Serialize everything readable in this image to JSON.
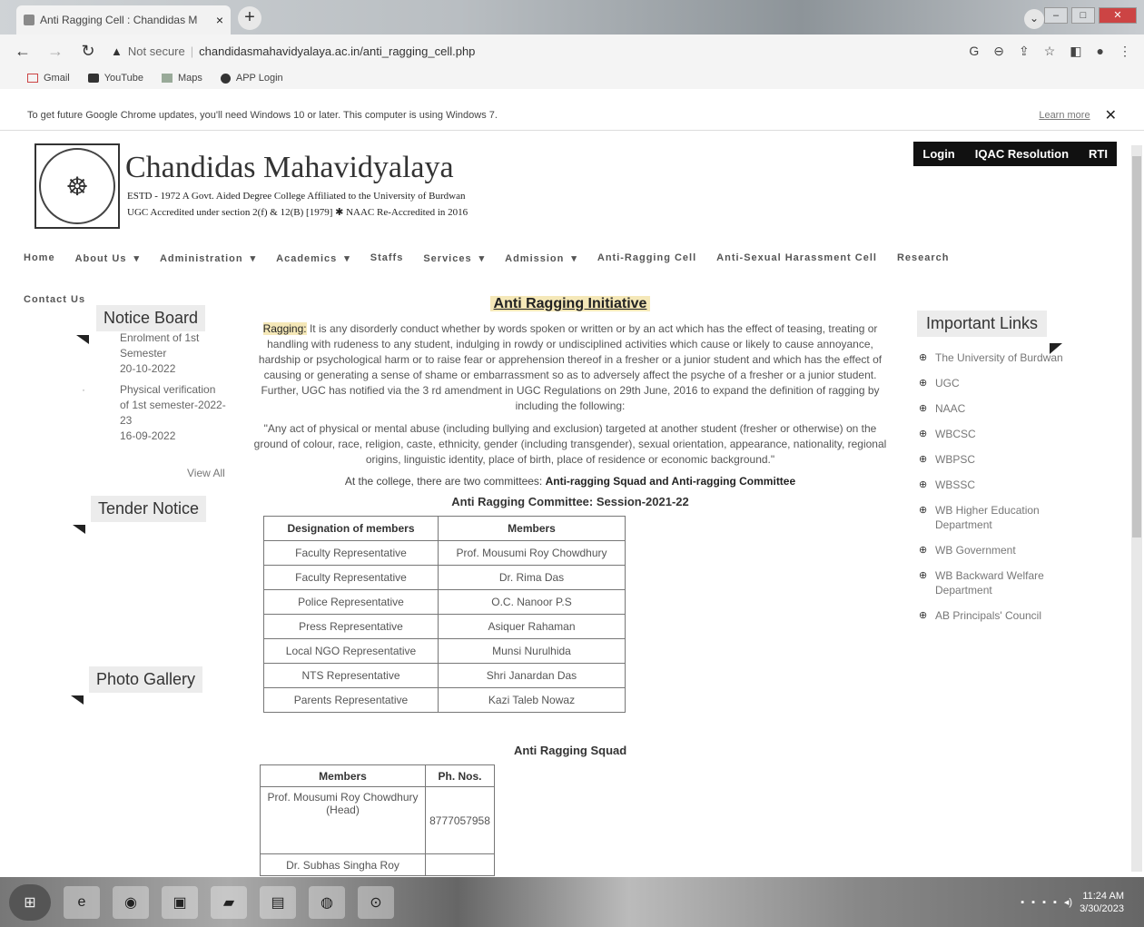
{
  "browser": {
    "tab_title": "Anti Ragging Cell : Chandidas M",
    "tab_close": "×",
    "new_tab": "+",
    "security_label": "Not secure",
    "url": "chandidasmahavidyalaya.ac.in/anti_ragging_cell.php",
    "bookmarks": [
      {
        "label": "Gmail",
        "icon": "gmail-icon"
      },
      {
        "label": "YouTube",
        "icon": "youtube-icon"
      },
      {
        "label": "Maps",
        "icon": "maps-icon"
      },
      {
        "label": "APP Login",
        "icon": "globe-icon"
      }
    ],
    "infobar_message": "To get future Google Chrome updates, you'll need Windows 10 or later. This computer is using Windows 7.",
    "infobar_link": "Learn more",
    "infobar_close": "✕"
  },
  "header": {
    "college_name": "Chandidas Mahavidyalaya",
    "sub1": "ESTD - 1972 A Govt. Aided Degree College Affiliated to the University of Burdwan",
    "sub2": "UGC Accredited under section 2(f) & 12(B) [1979] ✱ NAAC Re-Accredited in 2016",
    "topbar": [
      "Login",
      "IQAC Resolution",
      "RTI"
    ]
  },
  "nav": {
    "items": [
      "Home",
      "About Us",
      "Administration",
      "Academics",
      "Staffs",
      "Services",
      "Admission",
      "Anti-Ragging Cell",
      "Anti-Sexual Harassment Cell",
      "Research"
    ],
    "has_caret": [
      false,
      true,
      true,
      true,
      false,
      true,
      true,
      false,
      false,
      false
    ],
    "contact": "Contact Us"
  },
  "sidebar": {
    "notice_board_title": "Notice Board",
    "notices": [
      {
        "title": "Enrolment of 1st Semester",
        "date": "20-10-2022"
      },
      {
        "title": "Physical verification of 1st semester-2022-23",
        "date": "16-09-2022"
      }
    ],
    "view_all": "View All",
    "tender_title": "Tender Notice",
    "gallery_title": "Photo Gallery"
  },
  "main": {
    "heading": "Anti Ragging Initiative",
    "ragging_word": "Ragging:",
    "para1": "It is any disorderly conduct whether by words spoken or written or by an act which has the effect of teasing, treating or handling with rudeness to any student, indulging in rowdy or undisciplined activities which cause or likely to cause annoyance, hardship or psychological harm or to raise fear or apprehension thereof in a fresher or a junior student and which has the effect of causing or generating a sense of shame or embarrassment so as to adversely affect the psyche of a fresher or a junior student. Further, UGC has notified via the 3 rd amendment in UGC Regulations on 29th June, 2016 to expand the definition of ragging by including the following:",
    "para2": "\"Any act of physical or mental abuse (including bullying and exclusion) targeted at another student (fresher or otherwise) on the ground of colour, race, religion, caste, ethnicity, gender (including transgender), sexual orientation, appearance, nationality, regional origins, linguistic identity, place of birth, place of residence or economic background.\"",
    "committees_prefix": "At the college, there are two committees: ",
    "committees_names": "Anti-ragging Squad and Anti-ragging Committee",
    "committee_title": "Anti Ragging Committee: Session-2021-22",
    "committee_headers": [
      "Designation of members",
      "Members"
    ],
    "committee_rows": [
      [
        "Faculty Representative",
        "Prof. Mousumi Roy Chowdhury"
      ],
      [
        "Faculty Representative",
        "Dr. Rima Das"
      ],
      [
        "Police Representative",
        "O.C. Nanoor P.S"
      ],
      [
        "Press Representative",
        "Asiquer Rahaman"
      ],
      [
        "Local NGO Representative",
        "Munsi Nurulhida"
      ],
      [
        "NTS Representative",
        "Shri Janardan Das"
      ],
      [
        "Parents Representative",
        "Kazi Taleb Nowaz"
      ]
    ],
    "squad_title": "Anti Ragging Squad",
    "squad_headers": [
      "Members",
      "Ph. Nos."
    ],
    "squad_rows": [
      [
        "Prof. Mousumi Roy Chowdhury (Head)",
        "8777057958"
      ],
      [
        "Dr. Subhas Singha Roy",
        ""
      ]
    ]
  },
  "important_links": {
    "title": "Important Links",
    "items": [
      "The University of Burdwan",
      "UGC",
      "NAAC",
      "WBCSC",
      "WBPSC",
      "WBSSC",
      "WB Higher Education Department",
      "WB Government",
      "WB Backward Welfare Department",
      "AB Principals' Council"
    ]
  },
  "taskbar": {
    "time": "11:24 AM",
    "date": "3/30/2023"
  }
}
